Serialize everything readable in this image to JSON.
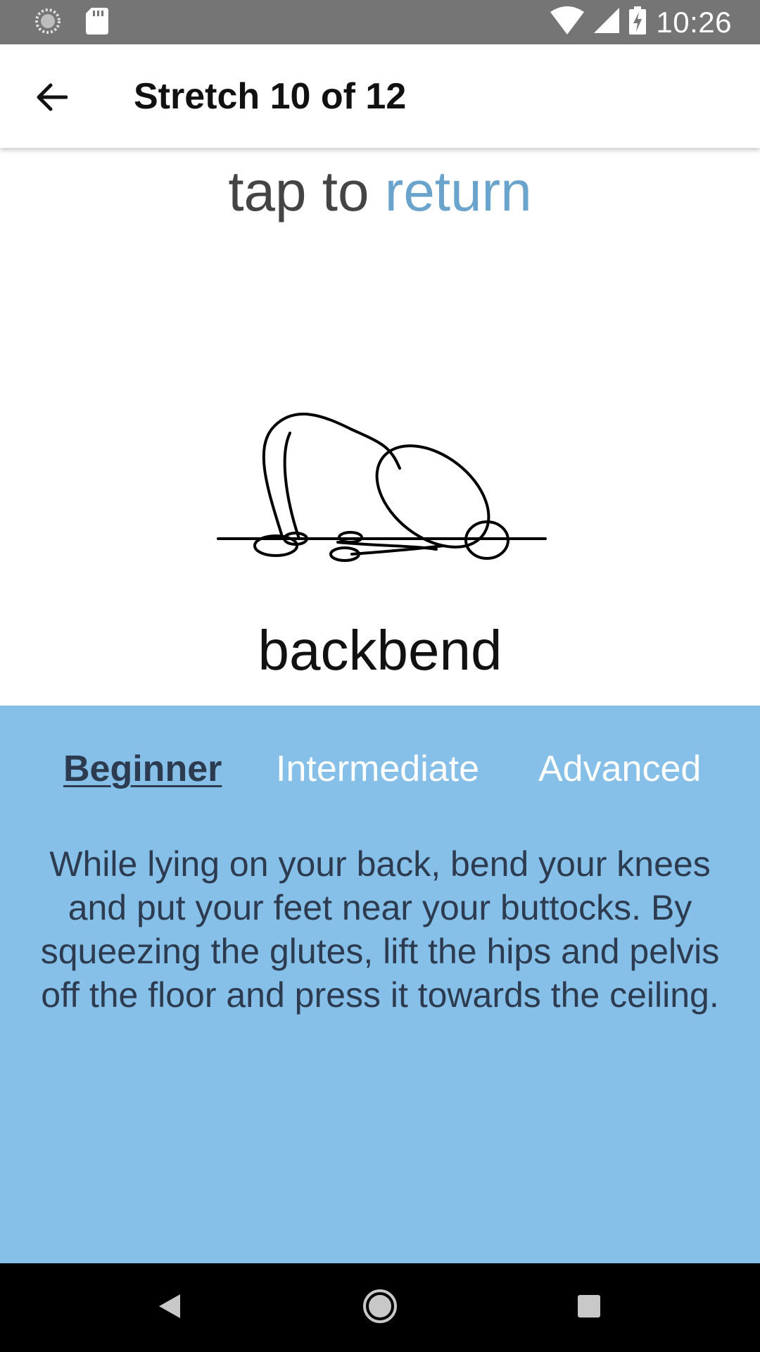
{
  "status_bar": {
    "time": "10:26",
    "icons": [
      "sync-icon",
      "sd-card-icon",
      "wifi-icon",
      "cell-signal-icon",
      "battery-charging-icon"
    ]
  },
  "app_bar": {
    "title": "Stretch 10 of 12",
    "back_icon": "arrow-left-icon"
  },
  "prompt": {
    "prefix": "tap to",
    "link": "return"
  },
  "stretch": {
    "name": "backbend",
    "illustration": "backbend-figure-icon"
  },
  "panel": {
    "background": "#86bfe7",
    "text_color": "#2c3b4f",
    "tabs": [
      {
        "label": "Beginner",
        "active": true
      },
      {
        "label": "Intermediate",
        "active": false
      },
      {
        "label": "Advanced",
        "active": false
      }
    ],
    "description": "While lying on your back, bend your knees and put your feet near your buttocks. By squeezing the glutes, lift the hips and pelvis off the floor and press it towards the ceiling."
  },
  "nav_bar": {
    "icons": [
      "nav-back-icon",
      "nav-home-icon",
      "nav-recents-icon"
    ]
  },
  "colors": {
    "status_bar": "#757575",
    "link": "#6aa4cc",
    "nav_bar": "#000000"
  }
}
